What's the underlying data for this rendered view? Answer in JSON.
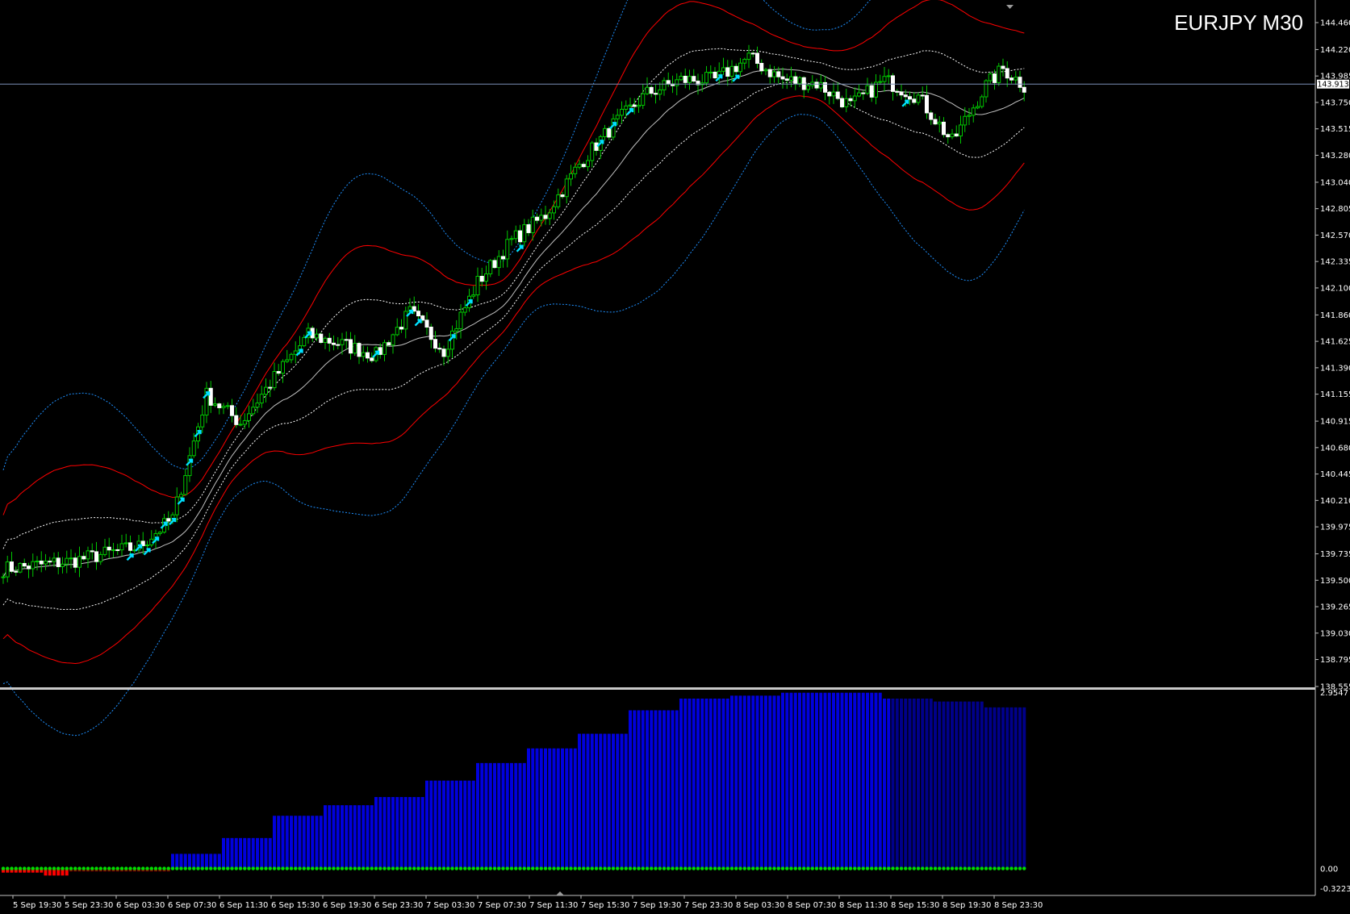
{
  "chart_data": {
    "symbol_label": "EURJPY M30",
    "main": {
      "type": "candlestick",
      "price_ticks": [
        "144.460",
        "144.220",
        "143.985",
        "143.750",
        "143.515",
        "143.280",
        "143.040",
        "142.805",
        "142.570",
        "142.335",
        "142.100",
        "141.860",
        "141.625",
        "141.390",
        "141.155",
        "140.915",
        "140.680",
        "140.445",
        "140.210",
        "139.975",
        "139.735",
        "139.500",
        "139.265",
        "139.030",
        "138.795",
        "138.555"
      ],
      "ylim": [
        138.555,
        144.46
      ],
      "current_price": "143.913",
      "time_labels": [
        "5 Sep 19:30",
        "5 Sep 23:30",
        "6 Sep 03:30",
        "6 Sep 07:30",
        "6 Sep 11:30",
        "6 Sep 15:30",
        "6 Sep 19:30",
        "6 Sep 23:30",
        "7 Sep 03:30",
        "7 Sep 07:30",
        "7 Sep 11:30",
        "7 Sep 15:30",
        "7 Sep 19:30",
        "7 Sep 23:30",
        "8 Sep 03:30",
        "8 Sep 07:30",
        "8 Sep 11:30",
        "8 Sep 15:30",
        "8 Sep 19:30",
        "8 Sep 23:30"
      ],
      "anchors": [
        [
          0,
          139.6
        ],
        [
          16,
          139.67
        ],
        [
          32,
          139.8
        ],
        [
          40,
          140.05
        ],
        [
          48,
          141.15
        ],
        [
          56,
          140.9
        ],
        [
          64,
          141.3
        ],
        [
          72,
          141.68
        ],
        [
          80,
          141.6
        ],
        [
          88,
          141.5
        ],
        [
          96,
          141.88
        ],
        [
          104,
          141.55
        ],
        [
          112,
          142.15
        ],
        [
          120,
          142.52
        ],
        [
          128,
          142.75
        ],
        [
          136,
          143.2
        ],
        [
          144,
          143.55
        ],
        [
          152,
          143.83
        ],
        [
          160,
          143.95
        ],
        [
          168,
          143.95
        ],
        [
          176,
          144.15
        ],
        [
          184,
          143.95
        ],
        [
          192,
          143.92
        ],
        [
          200,
          143.72
        ],
        [
          208,
          143.95
        ],
        [
          216,
          143.8
        ],
        [
          224,
          143.4
        ],
        [
          232,
          143.9
        ],
        [
          236,
          144.05
        ],
        [
          241,
          143.9
        ]
      ],
      "band_offsets": [
        0.25,
        0.55,
        0.95
      ],
      "ma_lag": 18,
      "series": [
        {
          "name": "",
          "color": "#c0c0c0",
          "role": "middle"
        },
        {
          "name": "",
          "color": "#ffffff",
          "role": "inner-dotted"
        },
        {
          "name": "",
          "color": "#ff0000",
          "role": "outer-solid"
        },
        {
          "name": "",
          "color": "#1e90ff",
          "role": "outer-dotted"
        }
      ],
      "signal_bars": [
        30,
        32,
        34,
        36,
        38,
        40,
        42,
        44,
        46,
        48,
        70,
        72,
        88,
        96,
        98,
        106,
        110,
        122,
        141,
        144,
        148,
        169,
        173,
        213
      ],
      "colors": {
        "bull": "#00c800",
        "bear": "#ffffff",
        "signal": "#00e0ff",
        "grid_line": "#7b8fb5"
      }
    },
    "indicator": {
      "type": "bar",
      "ylim": [
        -0.3223,
        2.9547
      ],
      "ticks": [
        "2.9547",
        "0.00",
        "-0.3223"
      ],
      "steps": [
        [
          0,
          -0.07
        ],
        [
          10,
          -0.12
        ],
        [
          16,
          -0.05
        ],
        [
          40,
          0.25
        ],
        [
          52,
          0.52
        ],
        [
          64,
          0.9
        ],
        [
          76,
          1.08
        ],
        [
          88,
          1.22
        ],
        [
          100,
          1.5
        ],
        [
          112,
          1.8
        ],
        [
          124,
          2.05
        ],
        [
          136,
          2.3
        ],
        [
          148,
          2.7
        ],
        [
          160,
          2.9
        ],
        [
          172,
          2.95
        ],
        [
          184,
          3.0
        ],
        [
          208,
          2.9
        ],
        [
          220,
          2.85
        ],
        [
          232,
          2.75
        ],
        [
          238,
          2.75
        ]
      ],
      "colors": {
        "positive": "#0000dd",
        "positive_fading": "#00008a",
        "negative": "#ff0000",
        "negative_dark": "#8b0000",
        "dots": "#00dd00"
      }
    }
  }
}
